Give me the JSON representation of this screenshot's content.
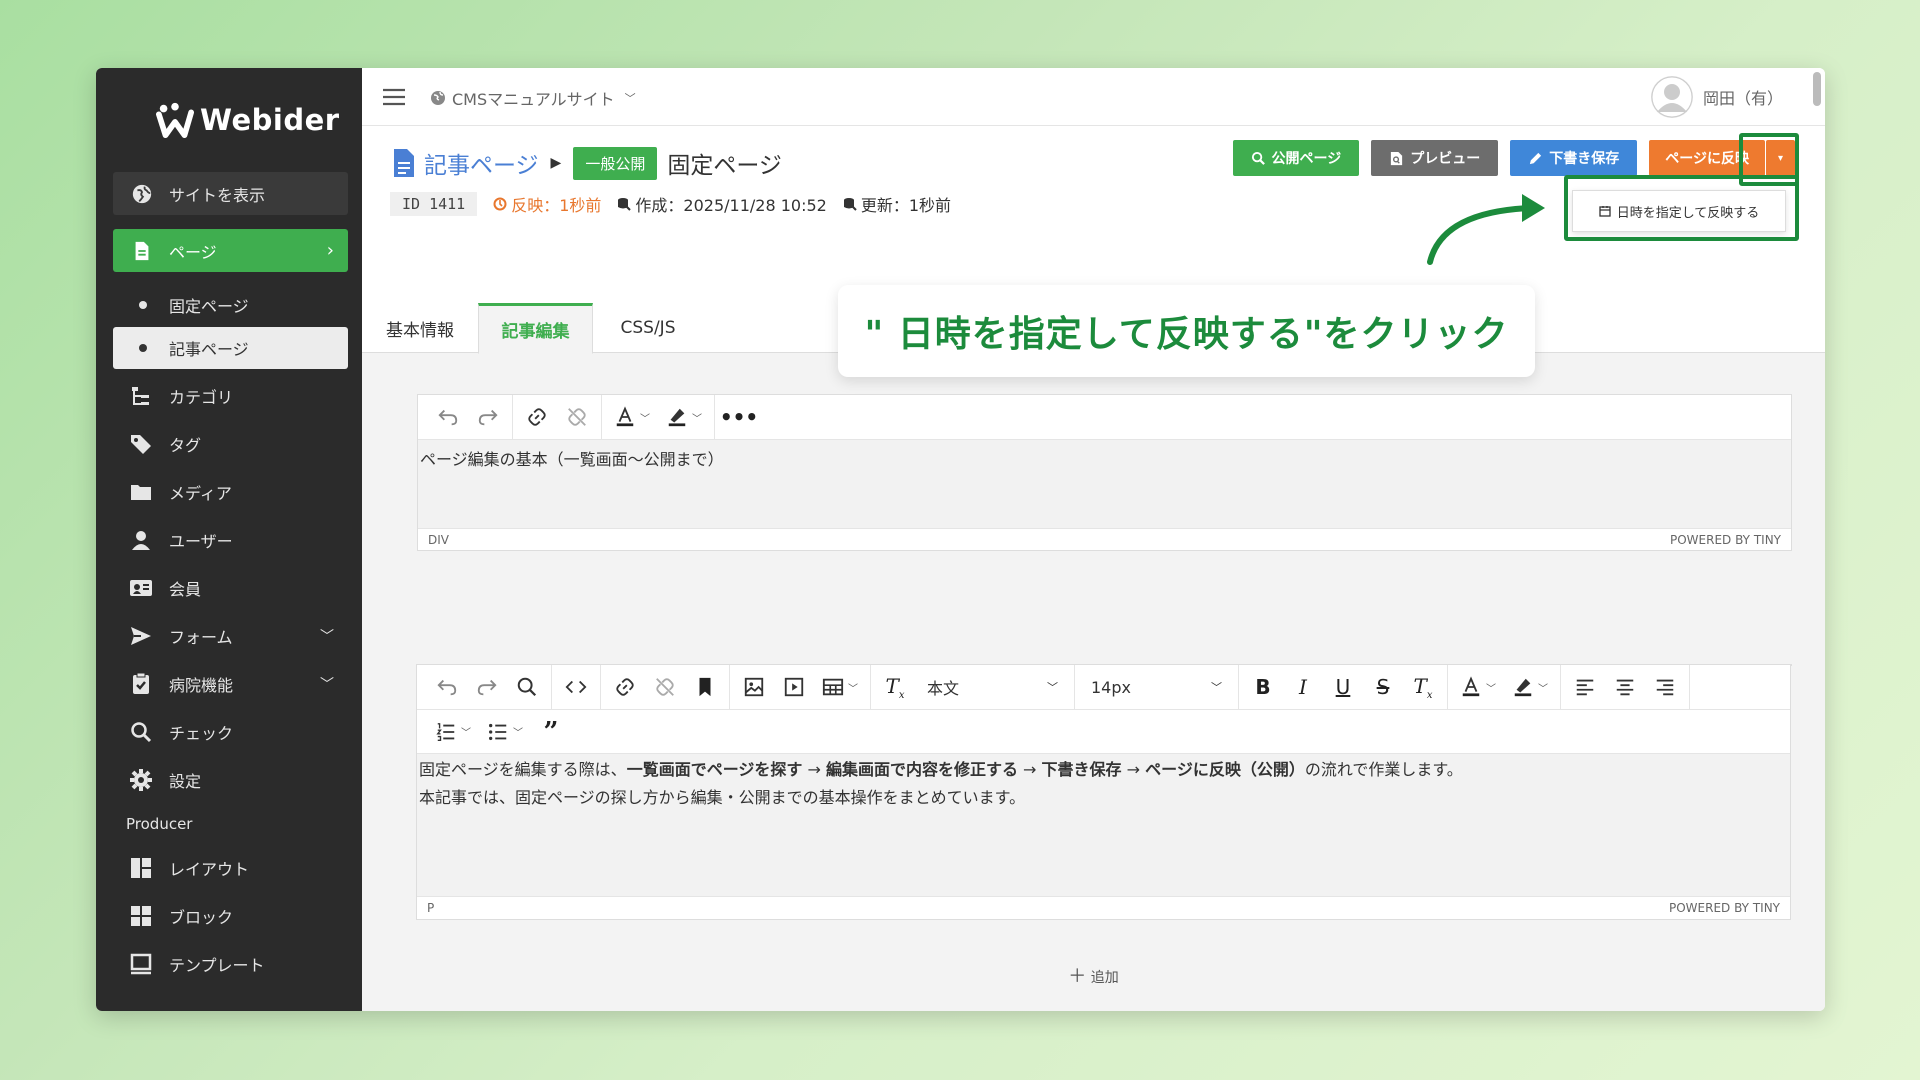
{
  "sidebar": {
    "logo": "Webider",
    "view_site": "サイトを表示",
    "page": "ページ",
    "sub_fixed": "固定ページ",
    "sub_article": "記事ページ",
    "category": "カテゴリ",
    "tag": "タグ",
    "media": "メディア",
    "user": "ユーザー",
    "member": "会員",
    "form": "フォーム",
    "hospital": "病院機能",
    "check": "チェック",
    "settings": "設定",
    "producer_heading": "Producer",
    "layout": "レイアウト",
    "block": "ブロック",
    "template": "テンプレート"
  },
  "topbar": {
    "site_name": "CMSマニュアルサイト",
    "user_name": "岡田（有）"
  },
  "header": {
    "breadcrumb": "記事ページ",
    "badge": "一般公開",
    "title": "固定ページ",
    "id_label": "ID 1411",
    "reflect": "反映：1秒前",
    "created": "作成：2025/11/28 10:52",
    "updated": "更新：1秒前"
  },
  "actions": {
    "public_page": "公開ページ",
    "preview": "プレビュー",
    "draft_save": "下書き保存",
    "reflect": "ページに反映",
    "caret": "▾",
    "scheduled_reflect": "日時を指定して反映する"
  },
  "tabs": {
    "basic": "基本情報",
    "edit": "記事編集",
    "cssjs": "CSS/JS"
  },
  "callout": "\" 日時を指定して反映する\"をクリック",
  "editor1": {
    "content": "ページ編集の基本（一覧画面〜公開まで）",
    "status_left": "DIV",
    "status_right": "POWERED BY TINY"
  },
  "add_label": "追加",
  "editor2": {
    "format": "本文",
    "size": "14px",
    "line1_prefix": "固定ページを編集する際は、",
    "line1_b1": "一覧画面でページを探す",
    "arrow": " → ",
    "line1_b2": "編集画面で内容を修正する",
    "line1_b3": "下書き保存",
    "line1_b4": "ページに反映（公開）",
    "line1_suffix": "の流れで作業します。",
    "line2": "本記事では、固定ページの探し方から編集・公開までの基本操作をまとめています。",
    "status_left": "P",
    "status_right": "POWERED BY TINY"
  },
  "colors": {
    "green": "#3fae4f",
    "blue": "#3f87d9",
    "orange": "#ee7a2f",
    "gray": "#6d6d6d",
    "highlight": "#1c8b3c"
  }
}
